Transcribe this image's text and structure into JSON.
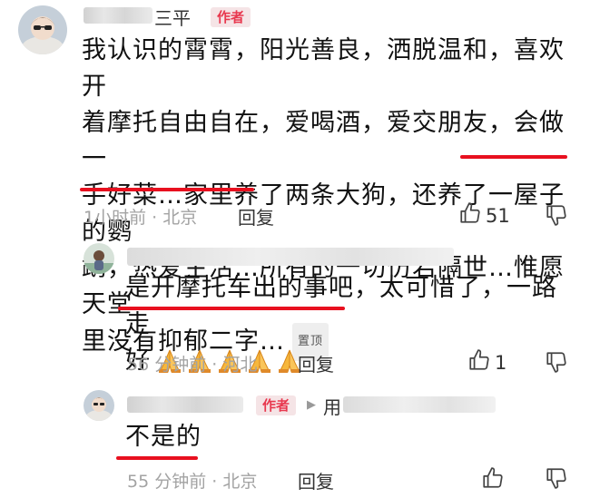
{
  "comment1": {
    "name_tail": "三平",
    "author_tag": "作者",
    "lines": [
      "我认识的霄霄，阳光善良，洒脱温和，喜欢开",
      "着摩托自由自在，爱喝酒，爱交朋友，会做一",
      "手好菜…家里养了两条大狗，还养了一屋子的鹦",
      "鹉，热爱生活…所有的一切仿若隔世…惟愿天堂"
    ],
    "last_line": "里没有抑郁二字…",
    "pin_badge": "置顶",
    "time_location": "1小时前 · 北京",
    "reply": "回复",
    "likes": "51"
  },
  "reply1": {
    "line1": "是开摩托车出的事吧，太可惜了，一路走",
    "line2": "好",
    "emoji_count": 5,
    "time_location": "56 分钟前 · 河北",
    "reply": "回复",
    "likes": "1"
  },
  "reply2": {
    "author_tag": "作者",
    "reply_to_char": "用",
    "text": "不是的",
    "time_location": "55 分钟前 · 北京",
    "reply": "回复"
  },
  "colors": {
    "underline": "#e8101f",
    "author_tag_text": "#e8384f",
    "author_tag_bg": "#f5e4e6",
    "meta_text": "#a3a3a3"
  },
  "icons": [
    "thumbs-up-icon",
    "thumbs-down-icon",
    "praying-hands-emoji",
    "play-arrow-icon"
  ]
}
